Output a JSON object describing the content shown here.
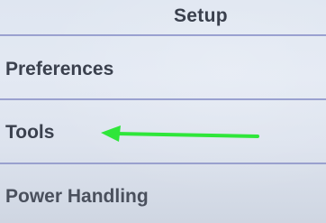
{
  "header": {
    "title": "Setup"
  },
  "menu": {
    "items": [
      {
        "label": "Preferences"
      },
      {
        "label": "Tools"
      },
      {
        "label": "Power Handling"
      }
    ]
  },
  "annotation": {
    "pointer": "green-arrow",
    "pointer_color": "#2fe63a",
    "points_to": "Tools"
  },
  "colors": {
    "screen_background": "#e0e6f0",
    "divider": "#8d94c9",
    "text": "#3b414e"
  }
}
